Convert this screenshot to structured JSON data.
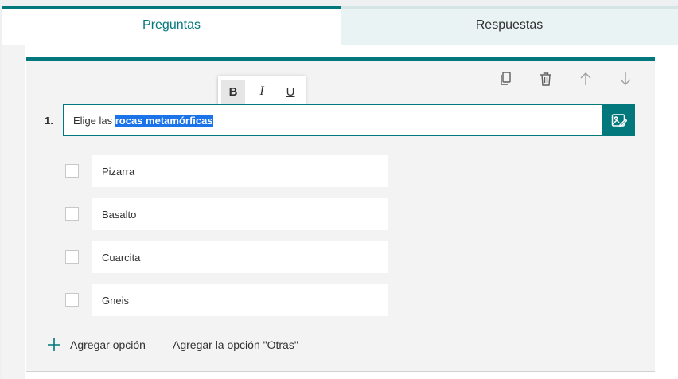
{
  "tabs": [
    {
      "label": "Preguntas",
      "active": true
    },
    {
      "label": "Respuestas",
      "active": false
    }
  ],
  "toolbar": {
    "icons": [
      "copy-icon",
      "trash-icon",
      "arrow-up-icon",
      "arrow-down-icon"
    ]
  },
  "format_popup": {
    "bold_label": "B",
    "italic_label": "I",
    "underline_label": "U"
  },
  "question": {
    "number": "1.",
    "text_plain": "Elige las ",
    "text_selected": "rocas metamórficas",
    "image_button_icon": "insert-image-icon"
  },
  "options": [
    {
      "label": "Pizarra"
    },
    {
      "label": "Basalto"
    },
    {
      "label": "Cuarcita"
    },
    {
      "label": "Gneis"
    }
  ],
  "actions": {
    "add_option": "Agregar opción",
    "add_other": "Agregar la opción \"Otras\""
  },
  "colors": {
    "accent": "#03787c",
    "selection": "#1a73e8"
  }
}
